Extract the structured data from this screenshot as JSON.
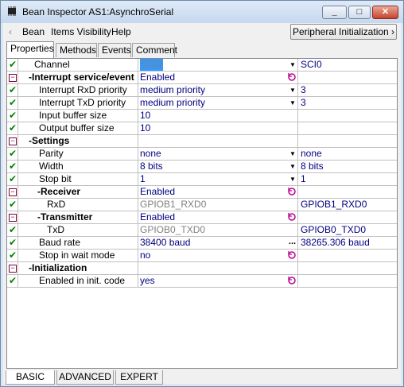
{
  "window": {
    "title": "Bean Inspector AS1:AsynchroSerial"
  },
  "menu": {
    "back": "‹",
    "items": [
      "Bean",
      "Items Visibility",
      "Help"
    ],
    "peripheral_button": "Peripheral Initialization ›"
  },
  "tabs": [
    "Properties",
    "Methods",
    "Events",
    "Comment"
  ],
  "rows": [
    {
      "name": "Channel",
      "value": "SCI0",
      "extra": "SCI0"
    },
    {
      "name": "-Interrupt service/event",
      "value": "Enabled",
      "extra": ""
    },
    {
      "name": "Interrupt RxD priority",
      "value": "medium priority",
      "extra": "3"
    },
    {
      "name": "Interrupt TxD priority",
      "value": "medium priority",
      "extra": "3"
    },
    {
      "name": "Input buffer size",
      "value": "10",
      "extra": ""
    },
    {
      "name": "Output buffer size",
      "value": "10",
      "extra": ""
    },
    {
      "name": "-Settings",
      "value": "",
      "extra": ""
    },
    {
      "name": "Parity",
      "value": "none",
      "extra": "none"
    },
    {
      "name": "Width",
      "value": "8 bits",
      "extra": "8 bits"
    },
    {
      "name": "Stop bit",
      "value": "1",
      "extra": "1"
    },
    {
      "name": "-Receiver",
      "value": "Enabled",
      "extra": ""
    },
    {
      "name": "RxD",
      "value": "GPIOB1_RXD0",
      "extra": "GPIOB1_RXD0"
    },
    {
      "name": "-Transmitter",
      "value": "Enabled",
      "extra": ""
    },
    {
      "name": "TxD",
      "value": "GPIOB0_TXD0",
      "extra": "GPIOB0_TXD0"
    },
    {
      "name": "Baud rate",
      "value": "38400 baud",
      "extra": "38265.306 baud"
    },
    {
      "name": "Stop in wait mode",
      "value": "no",
      "extra": ""
    },
    {
      "name": "-Initialization",
      "value": "",
      "extra": ""
    },
    {
      "name": "Enabled in init. code",
      "value": "yes",
      "extra": ""
    }
  ],
  "bottom_tabs": [
    "BASIC",
    "ADVANCED",
    "EXPERT"
  ],
  "icons": {
    "check": "✔",
    "collapse": "−",
    "dropdown": "▼",
    "ellipsis": "...",
    "reset": "reset-icon"
  },
  "colors": {
    "check": "#008000",
    "value": "#000080",
    "disabled_value": "#808080",
    "selection": "#3399ff"
  }
}
